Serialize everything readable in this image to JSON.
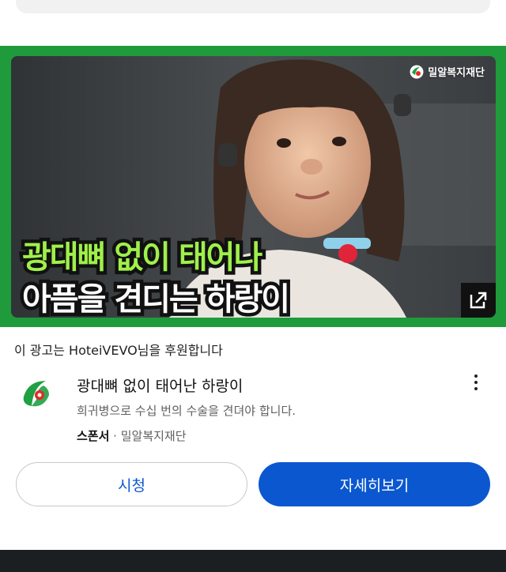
{
  "ad": {
    "thumbnail": {
      "logo_text": "밀알복지재단",
      "overlay_line1": "광대뼈 없이 태어나",
      "overlay_line2": "아픔을 견디는 하랑이"
    },
    "sponsor_note": "이 광고는 HoteiVEVO님을 후원합니다",
    "title": "광대뼈 없이 태어난 하랑이",
    "description": "희귀병으로 수십 번의 수술을 견뎌야 합니다.",
    "sponsor_label": "스폰서",
    "separator": " · ",
    "advertiser": "밀알복지재단",
    "buttons": {
      "watch": "시청",
      "details": "자세히보기"
    }
  },
  "colors": {
    "frame_green": "#1f9b3b",
    "accent_blue": "#0b57d0",
    "overlay_green": "#9ff04a"
  },
  "icons": [
    "brand-logo-icon",
    "external-link-icon",
    "more-vert-icon"
  ]
}
